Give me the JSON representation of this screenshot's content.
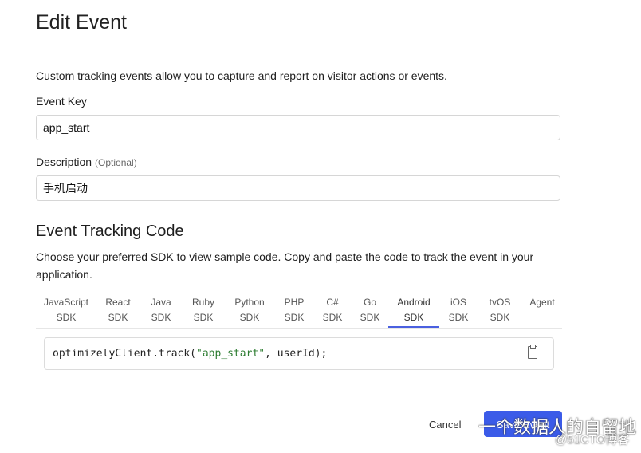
{
  "title": "Edit Event",
  "intro": "Custom tracking events allow you to capture and report on visitor actions or events.",
  "event_key": {
    "label": "Event Key",
    "value": "app_start"
  },
  "description": {
    "label": "Description",
    "optional": "(Optional)",
    "value": "手机启动"
  },
  "tracking": {
    "heading": "Event Tracking Code",
    "instructions": "Choose your preferred SDK to view sample code. Copy and paste the code to track the event in your application.",
    "tabs": [
      {
        "l1": "JavaScript",
        "l2": "SDK"
      },
      {
        "l1": "React",
        "l2": "SDK"
      },
      {
        "l1": "Java",
        "l2": "SDK"
      },
      {
        "l1": "Ruby",
        "l2": "SDK"
      },
      {
        "l1": "Python",
        "l2": "SDK"
      },
      {
        "l1": "PHP",
        "l2": "SDK"
      },
      {
        "l1": "C#",
        "l2": "SDK"
      },
      {
        "l1": "Go",
        "l2": "SDK"
      },
      {
        "l1": "Android",
        "l2": "SDK"
      },
      {
        "l1": "iOS",
        "l2": "SDK"
      },
      {
        "l1": "tvOS",
        "l2": "SDK"
      },
      {
        "l1": "Agent",
        "l2": ""
      }
    ],
    "active_tab": "Android SDK",
    "code": {
      "pre": "optimizelyClient.track(",
      "str": "\"app_start\"",
      "post": ", userId);"
    }
  },
  "footer": {
    "cancel": "Cancel",
    "save": "Save Event"
  },
  "watermark": {
    "line1": "一个数据人的自留地",
    "line2": "@51CTO博客"
  },
  "colors": {
    "accent": "#3b5be8",
    "tab_underline": "#4a60e0",
    "code_string": "#2e7d32"
  }
}
